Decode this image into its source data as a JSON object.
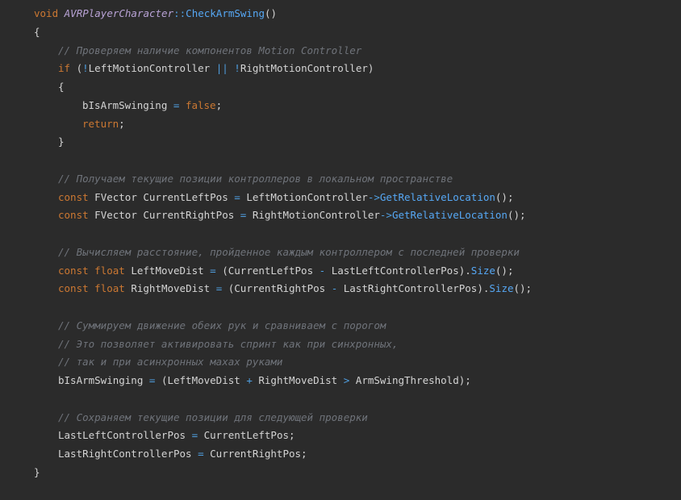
{
  "code_lines": [
    {
      "indent": 0,
      "tokens": [
        {
          "t": "void",
          "k": "keyword"
        },
        {
          "t": " ",
          "k": "ident"
        },
        {
          "t": "AVRPlayerCharacter",
          "k": "class"
        },
        {
          "t": "::",
          "k": "op"
        },
        {
          "t": "CheckArmSwing",
          "k": "method"
        },
        {
          "t": "()",
          "k": "punct"
        }
      ]
    },
    {
      "indent": 0,
      "tokens": [
        {
          "t": "{",
          "k": "punct"
        }
      ]
    },
    {
      "indent": 1,
      "tokens": [
        {
          "t": "// Проверяем наличие компонентов Motion Controller",
          "k": "comment"
        }
      ]
    },
    {
      "indent": 1,
      "tokens": [
        {
          "t": "if",
          "k": "keyword"
        },
        {
          "t": " (",
          "k": "punct"
        },
        {
          "t": "!",
          "k": "op"
        },
        {
          "t": "LeftMotionController",
          "k": "ident"
        },
        {
          "t": " ",
          "k": "ident"
        },
        {
          "t": "||",
          "k": "op"
        },
        {
          "t": " ",
          "k": "ident"
        },
        {
          "t": "!",
          "k": "op"
        },
        {
          "t": "RightMotionController",
          "k": "ident"
        },
        {
          "t": ")",
          "k": "punct"
        }
      ]
    },
    {
      "indent": 1,
      "tokens": [
        {
          "t": "{",
          "k": "punct"
        }
      ]
    },
    {
      "indent": 2,
      "tokens": [
        {
          "t": "bIsArmSwinging",
          "k": "ident"
        },
        {
          "t": " ",
          "k": "ident"
        },
        {
          "t": "=",
          "k": "op"
        },
        {
          "t": " ",
          "k": "ident"
        },
        {
          "t": "false",
          "k": "keyword"
        },
        {
          "t": ";",
          "k": "punct"
        }
      ]
    },
    {
      "indent": 2,
      "tokens": [
        {
          "t": "return",
          "k": "keyword"
        },
        {
          "t": ";",
          "k": "punct"
        }
      ]
    },
    {
      "indent": 1,
      "tokens": [
        {
          "t": "}",
          "k": "punct"
        }
      ]
    },
    {
      "indent": 1,
      "tokens": []
    },
    {
      "indent": 1,
      "tokens": [
        {
          "t": "// Получаем текущие позиции контроллеров в локальном пространстве",
          "k": "comment"
        }
      ]
    },
    {
      "indent": 1,
      "tokens": [
        {
          "t": "const",
          "k": "keyword"
        },
        {
          "t": " FVector CurrentLeftPos ",
          "k": "ident"
        },
        {
          "t": "=",
          "k": "op"
        },
        {
          "t": " LeftMotionController",
          "k": "ident"
        },
        {
          "t": "->",
          "k": "op"
        },
        {
          "t": "GetRelativeLocation",
          "k": "method"
        },
        {
          "t": "();",
          "k": "punct"
        }
      ]
    },
    {
      "indent": 1,
      "tokens": [
        {
          "t": "const",
          "k": "keyword"
        },
        {
          "t": " FVector CurrentRightPos ",
          "k": "ident"
        },
        {
          "t": "=",
          "k": "op"
        },
        {
          "t": " RightMotionController",
          "k": "ident"
        },
        {
          "t": "->",
          "k": "op"
        },
        {
          "t": "GetRelativeLocation",
          "k": "method"
        },
        {
          "t": "();",
          "k": "punct"
        }
      ]
    },
    {
      "indent": 1,
      "tokens": []
    },
    {
      "indent": 1,
      "tokens": [
        {
          "t": "// Вычисляем расстояние, пройденное каждым контроллером с последней проверки",
          "k": "comment"
        }
      ]
    },
    {
      "indent": 1,
      "tokens": [
        {
          "t": "const",
          "k": "keyword"
        },
        {
          "t": " ",
          "k": "ident"
        },
        {
          "t": "float",
          "k": "type"
        },
        {
          "t": " LeftMoveDist ",
          "k": "ident"
        },
        {
          "t": "=",
          "k": "op"
        },
        {
          "t": " (CurrentLeftPos ",
          "k": "ident"
        },
        {
          "t": "-",
          "k": "op"
        },
        {
          "t": " LastLeftControllerPos).",
          "k": "ident"
        },
        {
          "t": "Size",
          "k": "method"
        },
        {
          "t": "();",
          "k": "punct"
        }
      ]
    },
    {
      "indent": 1,
      "tokens": [
        {
          "t": "const",
          "k": "keyword"
        },
        {
          "t": " ",
          "k": "ident"
        },
        {
          "t": "float",
          "k": "type"
        },
        {
          "t": " RightMoveDist ",
          "k": "ident"
        },
        {
          "t": "=",
          "k": "op"
        },
        {
          "t": " (CurrentRightPos ",
          "k": "ident"
        },
        {
          "t": "-",
          "k": "op"
        },
        {
          "t": " LastRightControllerPos).",
          "k": "ident"
        },
        {
          "t": "Size",
          "k": "method"
        },
        {
          "t": "();",
          "k": "punct"
        }
      ]
    },
    {
      "indent": 1,
      "tokens": []
    },
    {
      "indent": 1,
      "tokens": [
        {
          "t": "// Суммируем движение обеих рук и сравниваем с порогом",
          "k": "comment"
        }
      ]
    },
    {
      "indent": 1,
      "tokens": [
        {
          "t": "// Это позволяет активировать спринт как при синхронных,",
          "k": "comment"
        }
      ]
    },
    {
      "indent": 1,
      "tokens": [
        {
          "t": "// так и при асинхронных махах руками",
          "k": "comment"
        }
      ]
    },
    {
      "indent": 1,
      "tokens": [
        {
          "t": "bIsArmSwinging ",
          "k": "ident"
        },
        {
          "t": "=",
          "k": "op"
        },
        {
          "t": " (LeftMoveDist ",
          "k": "ident"
        },
        {
          "t": "+",
          "k": "op"
        },
        {
          "t": " RightMoveDist ",
          "k": "ident"
        },
        {
          "t": ">",
          "k": "op"
        },
        {
          "t": " ArmSwingThreshold);",
          "k": "ident"
        }
      ]
    },
    {
      "indent": 1,
      "tokens": []
    },
    {
      "indent": 1,
      "tokens": [
        {
          "t": "// Сохраняем текущие позиции для следующей проверки",
          "k": "comment"
        }
      ]
    },
    {
      "indent": 1,
      "tokens": [
        {
          "t": "LastLeftControllerPos ",
          "k": "ident"
        },
        {
          "t": "=",
          "k": "op"
        },
        {
          "t": " CurrentLeftPos;",
          "k": "ident"
        }
      ]
    },
    {
      "indent": 1,
      "tokens": [
        {
          "t": "LastRightControllerPos ",
          "k": "ident"
        },
        {
          "t": "=",
          "k": "op"
        },
        {
          "t": " CurrentRightPos;",
          "k": "ident"
        }
      ]
    },
    {
      "indent": 0,
      "tokens": [
        {
          "t": "}",
          "k": "punct"
        }
      ]
    }
  ]
}
